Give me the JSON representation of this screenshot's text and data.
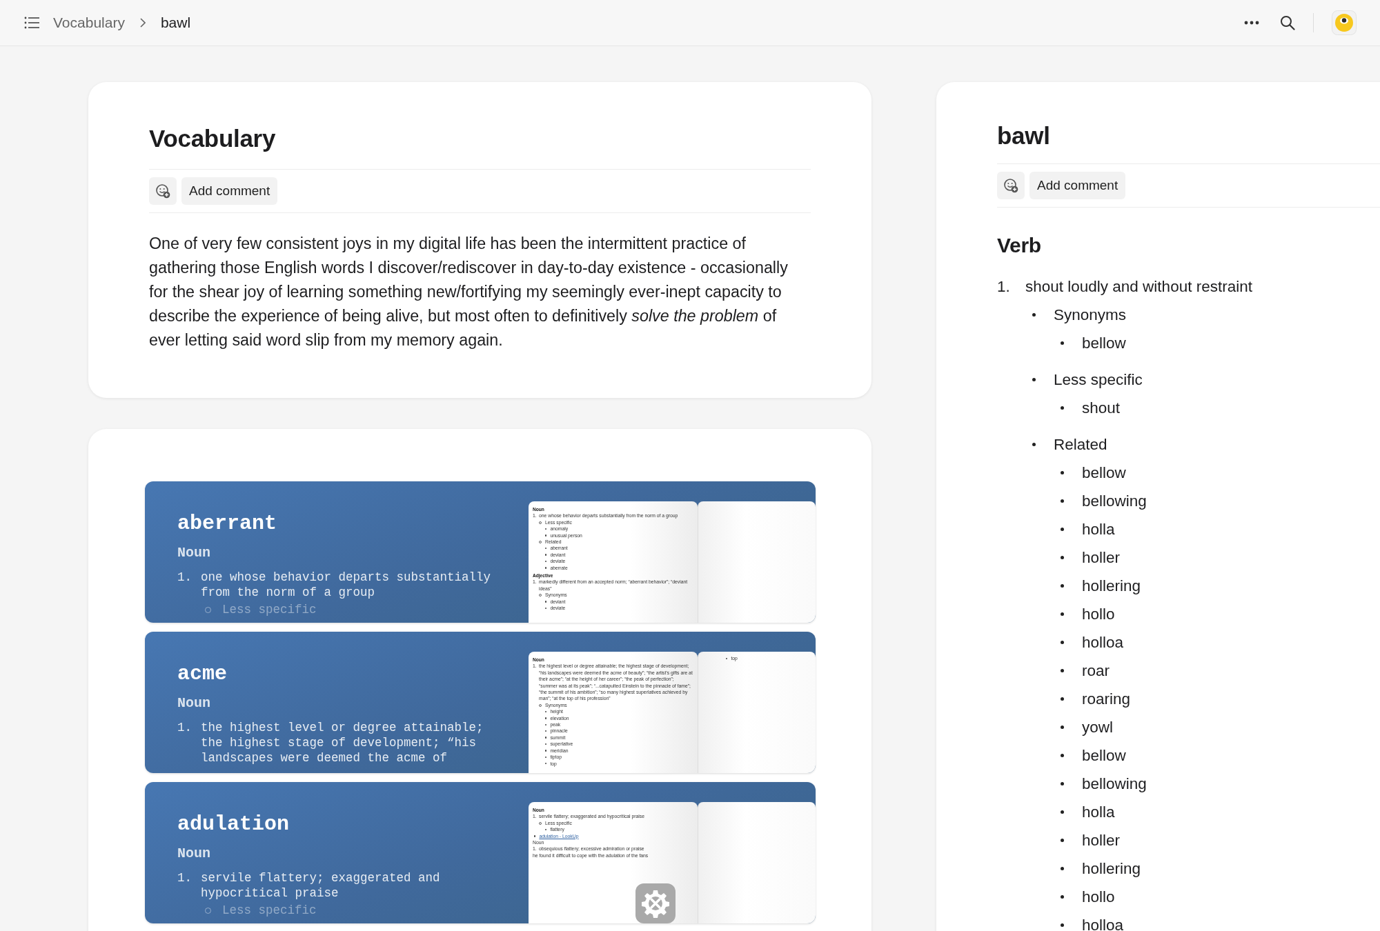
{
  "topbar": {
    "breadcrumbs": [
      {
        "label": "Vocabulary",
        "current": false
      },
      {
        "label": "bawl",
        "current": true
      }
    ]
  },
  "main_page": {
    "title": "Vocabulary",
    "comment_button": "Add comment",
    "body": "One of very few consistent joys in my digital life has been the intermittent practice of gathering those English words I discover/rediscover in day-to-day existence - occasionally for the shear joy of learning something new/fortifying my seemingly ever-inept capacity to describe the experience of being alive, but most often to definitively *solve the problem* of ever letting said word slip from my memory again."
  },
  "gallery": {
    "entries": [
      {
        "word": "aberrant",
        "part_of_speech": "Noun",
        "number": "1.",
        "definition": "one whose behavior departs substantially from the norm of a group",
        "sub": "Less specific",
        "tool_badge": false,
        "thumbnail": {
          "left": [
            {
              "kind": "heading",
              "text": "Noun"
            },
            {
              "kind": "num",
              "n": "1.",
              "text": "one whose behavior departs substantially from the norm of a group"
            },
            {
              "kind": "sub",
              "text": "Less specific"
            },
            {
              "kind": "subsub",
              "text": "anomaly"
            },
            {
              "kind": "subsub",
              "text": "unusual person"
            },
            {
              "kind": "sub",
              "text": "Related"
            },
            {
              "kind": "subsub",
              "text": "aberrant"
            },
            {
              "kind": "subsub",
              "text": "deviant"
            },
            {
              "kind": "subsub",
              "text": "deviate"
            },
            {
              "kind": "subsub",
              "text": "aberrate"
            },
            {
              "kind": "heading",
              "text": "Adjective"
            },
            {
              "kind": "num",
              "n": "1.",
              "text": "markedly different from an accepted norm; “aberrant behavior”; “deviant ideas”"
            },
            {
              "kind": "sub",
              "text": "Synonyms"
            },
            {
              "kind": "subsub",
              "text": "deviant"
            },
            {
              "kind": "subsub",
              "text": "deviate"
            }
          ]
        }
      },
      {
        "word": "acme",
        "part_of_speech": "Noun",
        "number": "1.",
        "definition": "the highest level or degree attainable; the highest stage of development; “his landscapes were deemed the acme of",
        "tool_badge": false,
        "thumbnail": {
          "left": [
            {
              "kind": "heading",
              "text": "Noun"
            },
            {
              "kind": "num",
              "n": "1.",
              "text": "the highest level or degree attainable; the highest stage of development; “his landscapes were deemed the acme of beauty”; “the artist’s gifts are at their acme”; “at the height of her career”; “the peak of perfection”; “summer was at its peak”; “...catapulted Einstein to the pinnacle of fame”; “the summit of his ambition”; “so many highest superlatives achieved by man”; “at the top of his profession”"
            },
            {
              "kind": "sub",
              "text": "Synonyms"
            },
            {
              "kind": "subsub",
              "text": "height"
            },
            {
              "kind": "subsub",
              "text": "elevation"
            },
            {
              "kind": "subsub",
              "text": "peak"
            },
            {
              "kind": "subsub",
              "text": "pinnacle"
            },
            {
              "kind": "subsub",
              "text": "summit"
            },
            {
              "kind": "subsub",
              "text": "superlative"
            },
            {
              "kind": "subsub",
              "text": "meridian"
            },
            {
              "kind": "subsub",
              "text": "tiptop"
            },
            {
              "kind": "subsub",
              "text": "top"
            }
          ],
          "right": [
            {
              "kind": "subsub",
              "text": "top"
            }
          ]
        }
      },
      {
        "word": "adulation",
        "part_of_speech": "Noun",
        "number": "1.",
        "definition": "servile flattery; exaggerated and hypocritical praise",
        "sub": "Less specific",
        "tool_badge": true,
        "thumbnail": {
          "left": [
            {
              "kind": "heading",
              "text": "Noun"
            },
            {
              "kind": "num",
              "n": "1.",
              "text": "servile flattery; exaggerated and hypocritical praise"
            },
            {
              "kind": "sub",
              "text": "Less specific"
            },
            {
              "kind": "subsub",
              "text": "flattery"
            },
            {
              "kind": "link",
              "text": "adulation - LookUp"
            },
            {
              "kind": "plain",
              "text": "Noun"
            },
            {
              "kind": "num",
              "n": "1.",
              "text": "obsequious flattery; excessive admiration or praise"
            },
            {
              "kind": "plain",
              "text": "he found it difficult to cope with the adulation of the fans"
            }
          ]
        }
      }
    ]
  },
  "side_page": {
    "title": "bawl",
    "comment_button": "Add comment",
    "heading": "Verb",
    "senses": [
      {
        "number": "1.",
        "text": "shout loudly and without restraint",
        "groups": [
          {
            "label": "Synonyms",
            "items": [
              "bellow"
            ]
          },
          {
            "label": "Less specific",
            "items": [
              "shout"
            ]
          },
          {
            "label": "Related",
            "items": [
              "bellow",
              "bellowing",
              "holla",
              "holler",
              "hollering",
              "hollo",
              "holloa",
              "roar",
              "roaring",
              "yowl",
              "bellow",
              "bellowing",
              "holla",
              "holler",
              "hollering",
              "hollo",
              "holloa"
            ]
          }
        ]
      }
    ]
  }
}
